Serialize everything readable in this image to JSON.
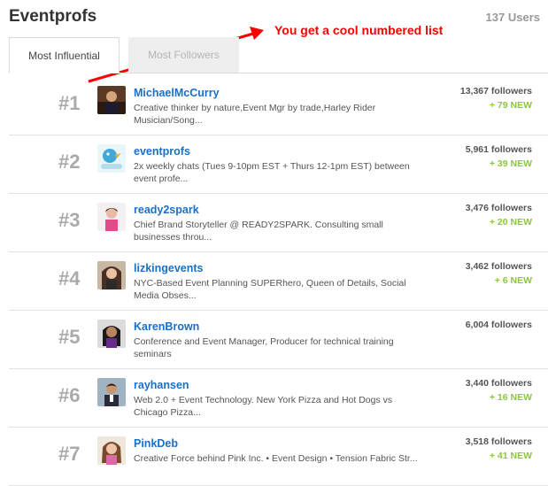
{
  "header": {
    "title": "Eventprofs",
    "user_count": "137 Users"
  },
  "annotation": {
    "text": "You get a cool numbered list",
    "color": "#ff0000"
  },
  "tabs": [
    {
      "label": "Most Influential",
      "active": true
    },
    {
      "label": "Most Followers",
      "active": false
    }
  ],
  "colors": {
    "link": "#1a6fc9",
    "new_followers": "#8cc63f",
    "rank": "#aaaaaa"
  },
  "users": [
    {
      "rank": "#1",
      "name": "MichaelMcCurry",
      "bio": "Creative thinker by nature,Event Mgr by trade,Harley Rider Musician/Song...",
      "followers": "13,367 followers",
      "new": "+ 79 NEW"
    },
    {
      "rank": "#2",
      "name": "eventprofs",
      "bio": "2x weekly chats (Tues 9-10pm EST + Thurs 12-1pm EST) between event profe...",
      "followers": "5,961 followers",
      "new": "+ 39 NEW"
    },
    {
      "rank": "#3",
      "name": "ready2spark",
      "bio": "Chief Brand Storyteller @ READY2SPARK. Consulting small businesses throu...",
      "followers": "3,476 followers",
      "new": "+ 20 NEW"
    },
    {
      "rank": "#4",
      "name": "lizkingevents",
      "bio": "NYC-Based Event Planning SUPERhero, Queen of Details, Social Media Obses...",
      "followers": "3,462 followers",
      "new": "+ 6 NEW"
    },
    {
      "rank": "#5",
      "name": "KarenBrown",
      "bio": "Conference and Event Manager, Producer for technical training seminars",
      "followers": "6,004 followers",
      "new": ""
    },
    {
      "rank": "#6",
      "name": "rayhansen",
      "bio": "Web 2.0 + Event Technology. New York Pizza and Hot Dogs vs Chicago Pizza...",
      "followers": "3,440 followers",
      "new": "+ 16 NEW"
    },
    {
      "rank": "#7",
      "name": "PinkDeb",
      "bio": "Creative Force behind Pink Inc. • Event Design • Tension Fabric Str...",
      "followers": "3,518 followers",
      "new": "+ 41 NEW"
    }
  ]
}
